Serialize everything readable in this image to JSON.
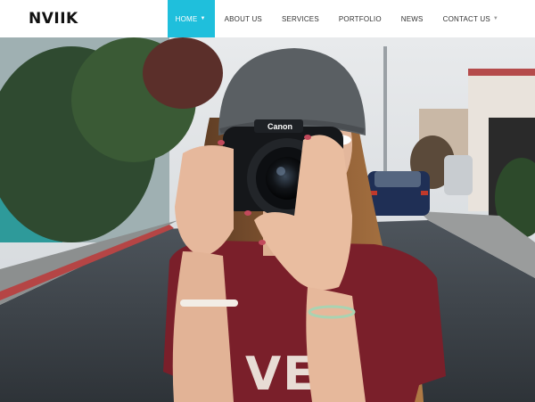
{
  "brand": {
    "logo_text": "NVIIK"
  },
  "nav": {
    "items": [
      {
        "label": "HOME",
        "active": true,
        "has_dropdown": true
      },
      {
        "label": "ABOUT US",
        "active": false,
        "has_dropdown": false
      },
      {
        "label": "SERVICES",
        "active": false,
        "has_dropdown": false
      },
      {
        "label": "PORTFOLIO",
        "active": false,
        "has_dropdown": false
      },
      {
        "label": "NEWS",
        "active": false,
        "has_dropdown": false
      },
      {
        "label": "CONTACT US",
        "active": false,
        "has_dropdown": true
      }
    ],
    "dropdown_icon": "chevron-down-icon",
    "active_color": "#1fbfdc"
  },
  "hero": {
    "camera_brand": "Canon",
    "shirt_text": "VER"
  }
}
